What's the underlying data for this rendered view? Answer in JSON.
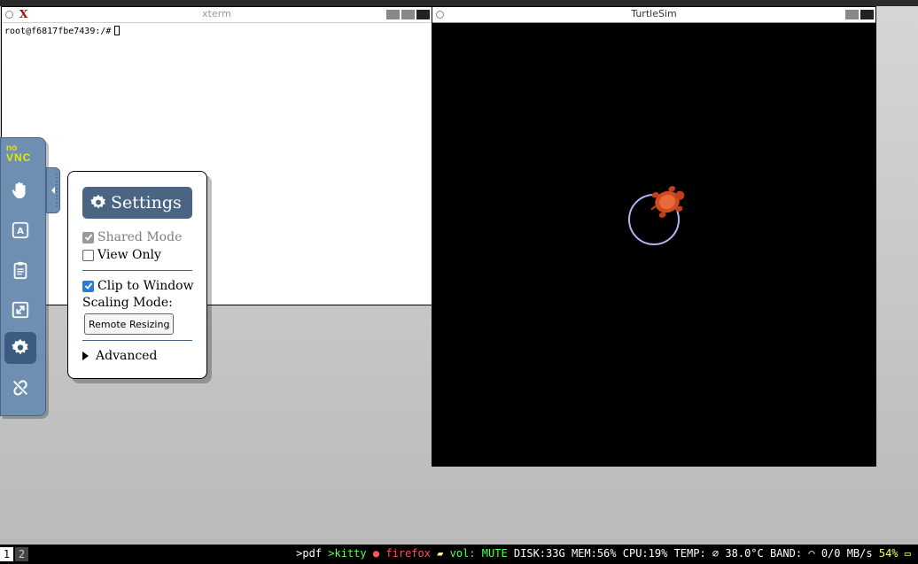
{
  "xterm": {
    "title": "xterm",
    "prompt": "root@f6817fbe7439:/#"
  },
  "turtlesim": {
    "title": "TurtleSim",
    "background": "#000000"
  },
  "novnc": {
    "logo_no": "no",
    "logo_vnc": "VNC",
    "buttons": [
      "drag-icon",
      "keyboard-icon",
      "clipboard-icon",
      "fullscreen-icon",
      "settings-icon",
      "disconnect-icon"
    ]
  },
  "settings": {
    "title": "Settings",
    "shared_mode": "Shared Mode",
    "view_only": "View Only",
    "clip_to_window": "Clip to Window",
    "scaling_mode_label": "Scaling Mode:",
    "scaling_mode_value": "Remote Resizing",
    "advanced": "Advanced",
    "shared_mode_checked": true,
    "view_only_checked": false,
    "clip_to_window_checked": true
  },
  "taskbar": {
    "workspace_1": "1",
    "workspace_2": "2",
    "pdf": ">pdf",
    "kitty": ">kitty",
    "firefox": "firefox",
    "vol_label": "vol:",
    "vol_value": "MUTE",
    "disk": "DISK:33G",
    "mem": "MEM:56%",
    "cpu": "CPU:19%",
    "temp_label": "TEMP:",
    "temp_value": "38.0°C",
    "band_label": "BAND:",
    "band_value": "0/0 MB/s",
    "battery": "54%",
    "accent": "#55ff55",
    "firefox_color": "#ff5555",
    "battery_color": "#ffff55"
  }
}
